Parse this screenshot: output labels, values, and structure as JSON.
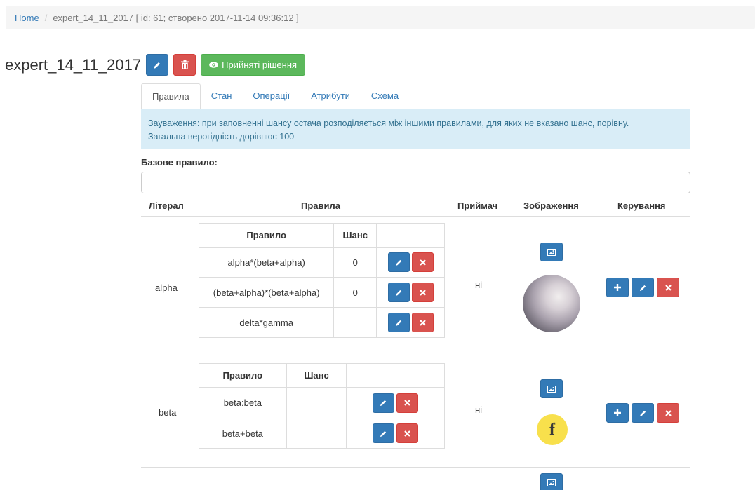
{
  "breadcrumb": {
    "home": "Home",
    "current": "expert_14_11_2017 [ id: 61; створено 2017-11-14 09:36:12 ]"
  },
  "page": {
    "title": "expert_14_11_2017",
    "decisions_button": "Прийняті рішення"
  },
  "tabs": [
    "Правила",
    "Стан",
    "Операції",
    "Атрибути",
    "Схема"
  ],
  "alert": {
    "line1": "Зауваження: при заповненні шансу остача розподіляється між іншими правилами, для яких не вказано шанс, порівну.",
    "line2": "Загальна верогідність дорівнює 100"
  },
  "base_rule": {
    "label": "Базове правило:",
    "value": ""
  },
  "columns": {
    "literal": "Літерал",
    "rules": "Правила",
    "acceptor": "Приймач",
    "image": "Зображення",
    "control": "Керування"
  },
  "rule_table_headers": {
    "rule": "Правило",
    "chance": "Шанс"
  },
  "rows": [
    {
      "literal": "alpha",
      "acceptor": "ні",
      "rules": [
        {
          "rule": "alpha*(beta+alpha)",
          "chance": "0"
        },
        {
          "rule": "(beta+alpha)*(beta+alpha)",
          "chance": "0"
        },
        {
          "rule": "delta*gamma",
          "chance": ""
        }
      ]
    },
    {
      "literal": "beta",
      "acceptor": "ні",
      "image_letter": "f",
      "rules": [
        {
          "rule": "beta:beta",
          "chance": ""
        },
        {
          "rule": "beta+beta",
          "chance": ""
        }
      ]
    }
  ],
  "colors": {
    "primary": "#337ab7",
    "danger": "#d9534f",
    "success": "#5cb85c",
    "info_bg": "#d9edf7",
    "info_text": "#31708f"
  }
}
